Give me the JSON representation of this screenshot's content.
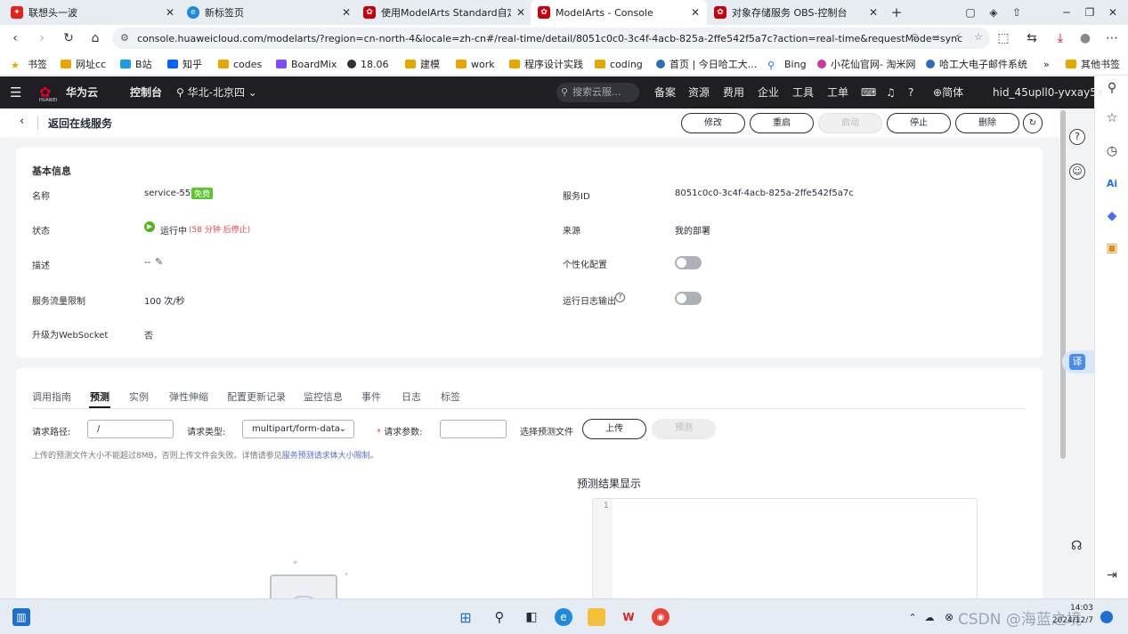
{
  "browser": {
    "tabs": [
      {
        "title": "联想头一波",
        "icon_color": "#e1251b"
      },
      {
        "title": "新标签页",
        "icon_color": "#1d8ae0"
      },
      {
        "title": "使用ModelArts Standard自定义",
        "icon_color": "#c7000b"
      },
      {
        "title": "ModelArts - Console",
        "icon_color": "#c7000b"
      },
      {
        "title": "对象存储服务 OBS-控制台",
        "icon_color": "#c7000b"
      }
    ],
    "new_tab": "+",
    "url": "console.huaweicloud.com/modelarts/?region=cn-north-4&locale=zh-cn#/real-time/detail/8051c0c0-3c4f-4acb-825a-2ffe542f5a7c?action=real-time&requestMode=sync",
    "bookmarks": [
      "书签",
      "网址cc",
      "B站",
      "知乎",
      "codes",
      "BoardMix",
      "18.06",
      "建模",
      "work",
      "程序设计实践",
      "coding",
      "首页 | 今日哈工大...",
      "Bing",
      "小花仙官网- 淘米网",
      "哈工大电子邮件系统"
    ],
    "bookmarks_more": "»",
    "other_bookmarks": "其他书签"
  },
  "console": {
    "brand": "华为云",
    "brand_sub": "HUAWEI",
    "console_label": "控制台",
    "region": "华北-北京四",
    "search_placeholder": "搜索云服...",
    "menu": [
      "备案",
      "资源",
      "费用",
      "企业",
      "工具",
      "工单"
    ],
    "lang": "简体",
    "user": "hid_45upll0-yvxay5x"
  },
  "page": {
    "back_label": "返回在线服务",
    "actions": [
      "修改",
      "重启",
      "启动",
      "停止",
      "删除"
    ],
    "basic_title": "基本信息",
    "fields": {
      "name_label": "名称",
      "name_value": "service-55fa",
      "free_badge": "免费",
      "service_id_label": "服务ID",
      "service_id_value": "8051c0c0-3c4f-4acb-825a-2ffe542f5a7c",
      "status_label": "状态",
      "status_value": "运行中",
      "status_note": "(58 分钟 后停止)",
      "source_label": "来源",
      "source_value": "我的部署",
      "desc_label": "描述",
      "desc_value": "--",
      "custom_label": "个性化配置",
      "flow_label": "服务流量限制",
      "flow_value": "100 次/秒",
      "log_label": "运行日志输出",
      "ws_label": "升级为WebSocket",
      "ws_value": "否"
    },
    "subtabs": [
      "调用指南",
      "预测",
      "实例",
      "弹性伸缩",
      "配置更新记录",
      "监控信息",
      "事件",
      "日志",
      "标签"
    ],
    "active_subtab": "预测",
    "predict": {
      "path_label": "请求路径:",
      "path_value": "/",
      "type_label": "请求类型:",
      "type_value": "multipart/form-data",
      "param_label": "请求参数:",
      "param_value": "",
      "file_label": "选择预测文件",
      "upload_label": "上传",
      "predict_label": "预测",
      "hint_prefix": "上传的预测文件大小不能超过8MB，否则上传文件会失败。详情请参见",
      "hint_link": "服务预测请求体大小限制",
      "hint_suffix": "。",
      "result_title": "预测结果显示",
      "line_no": "1"
    }
  },
  "taskbar": {
    "clock_time": "14:03",
    "clock_date": "2024/12/7",
    "watermark": "CSDN @海蓝之境"
  }
}
